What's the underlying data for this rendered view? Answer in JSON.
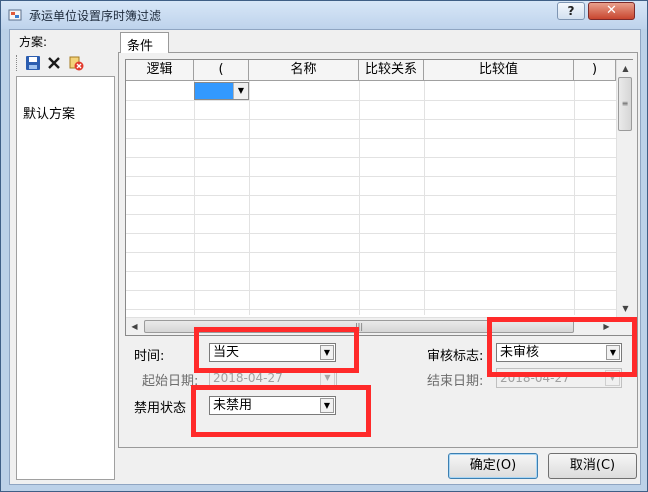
{
  "window": {
    "title": "承运单位设置序时簿过滤",
    "help_label": "?",
    "close_label": "✕"
  },
  "left": {
    "scheme_label": "方案:",
    "toolbar": [
      {
        "icon": "save-icon"
      },
      {
        "icon": "delete-icon"
      },
      {
        "icon": "clear-icon"
      }
    ],
    "schemes": [
      "默认方案"
    ]
  },
  "tab": {
    "label": "条件"
  },
  "grid": {
    "columns": [
      "逻辑",
      "(",
      "名称",
      "比较关系",
      "比较值",
      ")"
    ]
  },
  "filters": {
    "time_label": "时间:",
    "time_value": "当天",
    "audit_label": "审核标志:",
    "audit_value": "未审核",
    "start_label": "起始日期:",
    "start_value": "2018-04-27",
    "end_label": "结束日期:",
    "end_value": "2018-04-27",
    "disabled_label": "禁用状态",
    "disabled_value": "未禁用"
  },
  "buttons": {
    "ok": "确定(O)",
    "cancel": "取消(C)"
  },
  "colors": {
    "highlight": "#ff2a2a",
    "selection": "#3399ff"
  }
}
